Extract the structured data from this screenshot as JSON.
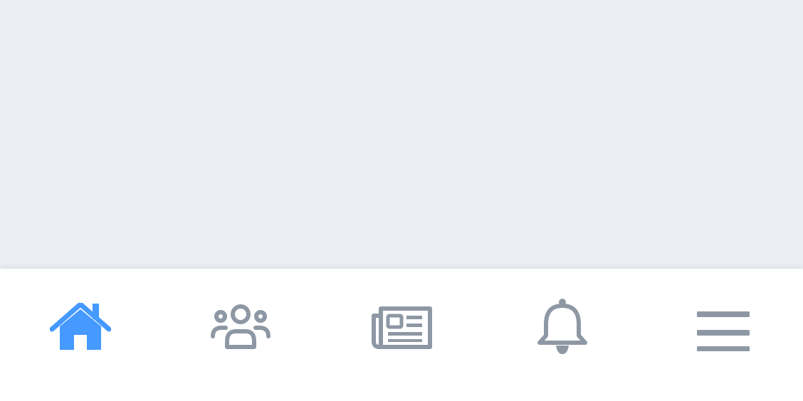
{
  "colors": {
    "background": "#ebeef3",
    "tab_bar": "#ffffff",
    "active": "#4599ff",
    "inactive": "#8e98a4"
  },
  "tab_bar": {
    "active_tab": "home",
    "tabs": [
      {
        "id": "home",
        "icon": "home-icon",
        "active": true
      },
      {
        "id": "friends",
        "icon": "people-group-icon",
        "active": false
      },
      {
        "id": "news",
        "icon": "newspaper-icon",
        "active": false
      },
      {
        "id": "notifications",
        "icon": "bell-icon",
        "active": false
      },
      {
        "id": "menu",
        "icon": "hamburger-menu-icon",
        "active": false
      }
    ]
  }
}
